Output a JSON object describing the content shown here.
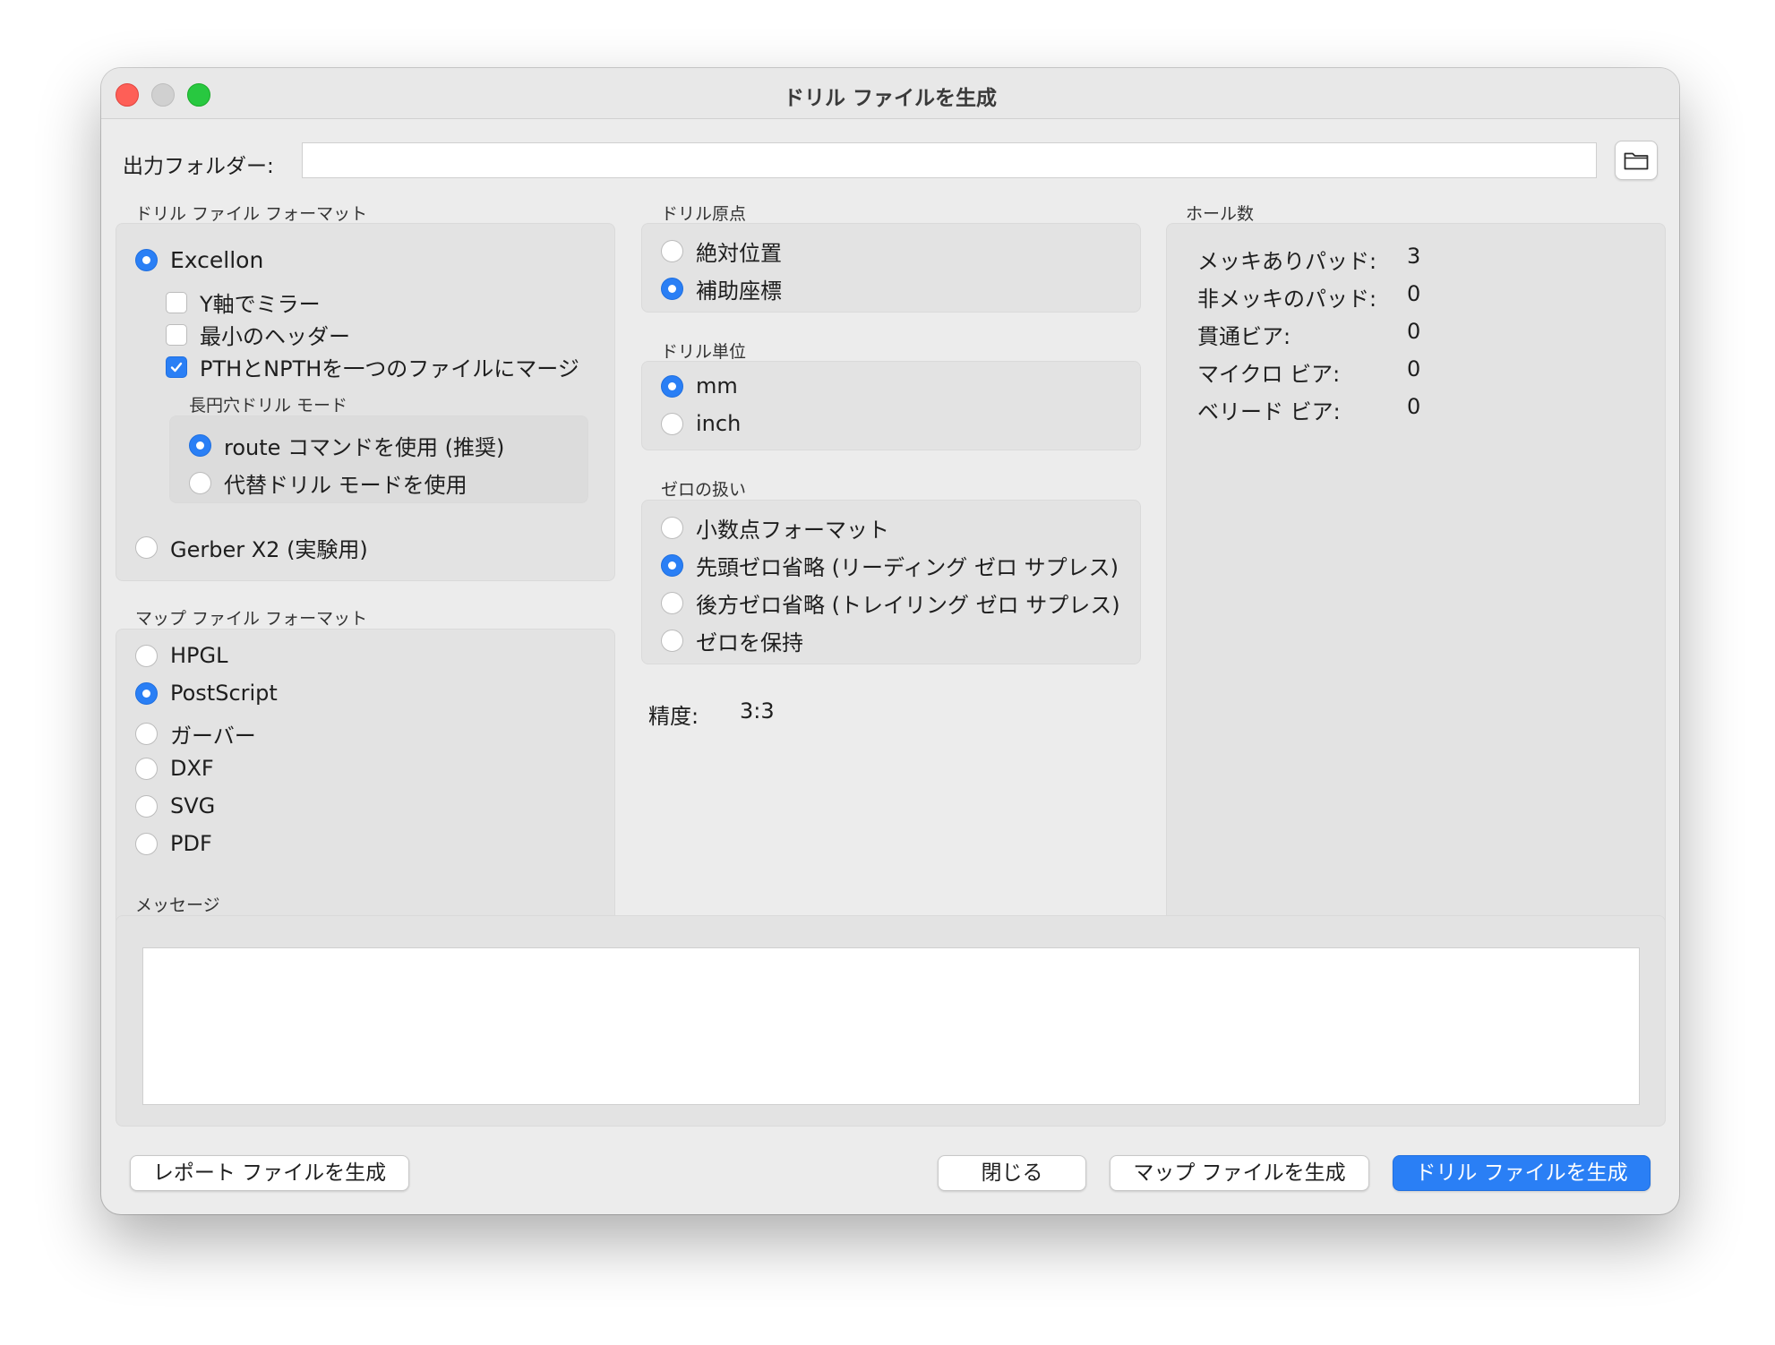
{
  "window": {
    "title": "ドリル ファイルを生成"
  },
  "output": {
    "label": "出力フォルダー:",
    "value": "",
    "browse_icon": "folder-icon"
  },
  "drill_format": {
    "label": "ドリル ファイル フォーマット",
    "excellon": "Excellon",
    "mirror_y": "Y軸でミラー",
    "minimal_header": "最小のヘッダー",
    "merge_pth": "PTHとNPTHを一つのファイルにマージ",
    "oval_label": "長円穴ドリル モード",
    "route_cmd": "route コマンドを使用 (推奨)",
    "alt_drill": "代替ドリル モードを使用",
    "gerber": "Gerber X2 (実験用)",
    "selected": "Excellon",
    "mirror_checked": false,
    "minimal_checked": false,
    "merge_checked": true,
    "oval_selected": "route"
  },
  "map_format": {
    "label": "マップ ファイル フォーマット",
    "options": [
      "HPGL",
      "PostScript",
      "ガーバー",
      "DXF",
      "SVG",
      "PDF"
    ],
    "selected": "PostScript"
  },
  "origin": {
    "label": "ドリル原点",
    "options": [
      "絶対位置",
      "補助座標"
    ],
    "selected": "補助座標"
  },
  "units": {
    "label": "ドリル単位",
    "options": [
      "mm",
      "inch"
    ],
    "selected": "mm"
  },
  "zeros": {
    "label": "ゼロの扱い",
    "options": [
      "小数点フォーマット",
      "先頭ゼロ省略 (リーディング ゼロ サプレス)",
      "後方ゼロ省略 (トレイリング ゼロ サプレス)",
      "ゼロを保持"
    ],
    "selected": "先頭ゼロ省略 (リーディング ゼロ サプレス)"
  },
  "precision": {
    "label": "精度:",
    "value": "3:3"
  },
  "holes": {
    "label": "ホール数",
    "rows": [
      {
        "label": "メッキありパッド:",
        "value": "3"
      },
      {
        "label": "非メッキのパッド:",
        "value": "0"
      },
      {
        "label": "貫通ビア:",
        "value": "0"
      },
      {
        "label": "マイクロ ビア:",
        "value": "0"
      },
      {
        "label": "ベリード ビア:",
        "value": "0"
      }
    ]
  },
  "messages": {
    "label": "メッセージ",
    "text": ""
  },
  "buttons": {
    "report": "レポート ファイルを生成",
    "close": "閉じる",
    "map": "マップ ファイルを生成",
    "drill": "ドリル ファイルを生成"
  }
}
